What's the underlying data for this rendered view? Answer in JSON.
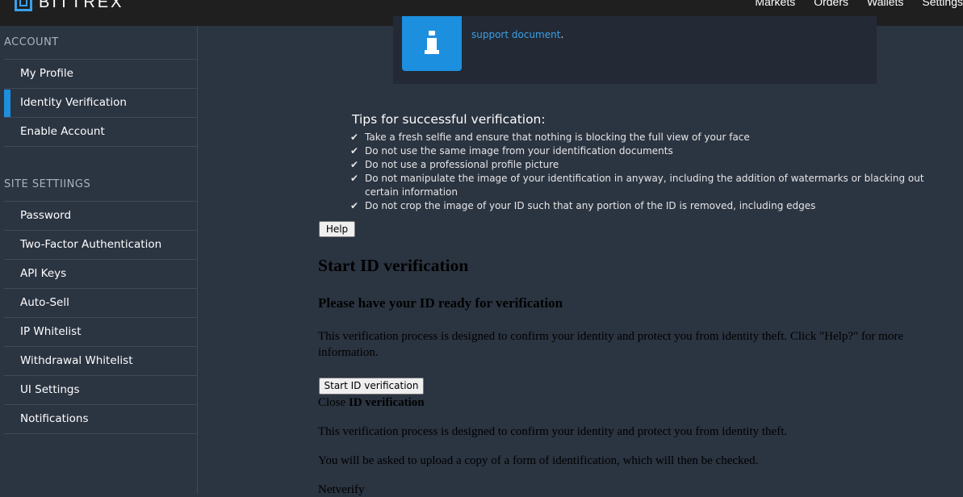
{
  "brand": {
    "name": "BITTREX",
    "accent": "#1d8fdf"
  },
  "nav": {
    "items": [
      "Markets",
      "Orders",
      "Wallets",
      "Settings"
    ]
  },
  "sidebar": {
    "account_title": "ACCOUNT",
    "account_items": [
      "My Profile",
      "Identity Verification",
      "Enable Account"
    ],
    "active_item": "Identity Verification",
    "site_settings_title": "SITE SETTIINGS",
    "site_items": [
      "Password",
      "Two-Factor Authentication",
      "API Keys",
      "Auto-Sell",
      "IP Whitelist",
      "Withdrawal Whitelist",
      "UI Settings",
      "Notifications"
    ]
  },
  "info": {
    "icon": "info-icon",
    "link_text": "support document",
    "trailing": "."
  },
  "tips": {
    "title": "Tips for successful verification:",
    "items": [
      "Take a fresh selfie and ensure that nothing is blocking the full view of your face",
      "Do not use the same image from your identification documents",
      "Do not use a professional profile picture",
      "Do not manipulate the image of your identification in anyway, including the addition of watermarks or blacking out certain information",
      "Do not crop the image of your ID such that any portion of the ID is removed, including edges"
    ]
  },
  "help_button": "Help",
  "verification": {
    "heading": "Start ID verification",
    "subheading": "Please have your ID ready for verification",
    "intro": "This verification process is designed to confirm your identity and protect you from identity theft. Click \"Help?\" for more information.",
    "start_button": "Start ID verification",
    "close_label": "Close",
    "close_bold": "ID verification",
    "para_confirm": "This verification process is designed to confirm your identity and protect you from identity theft.",
    "para_upload": "You will be asked to upload a copy of a form of identification, which will then be checked.",
    "provider": "Netverify"
  }
}
